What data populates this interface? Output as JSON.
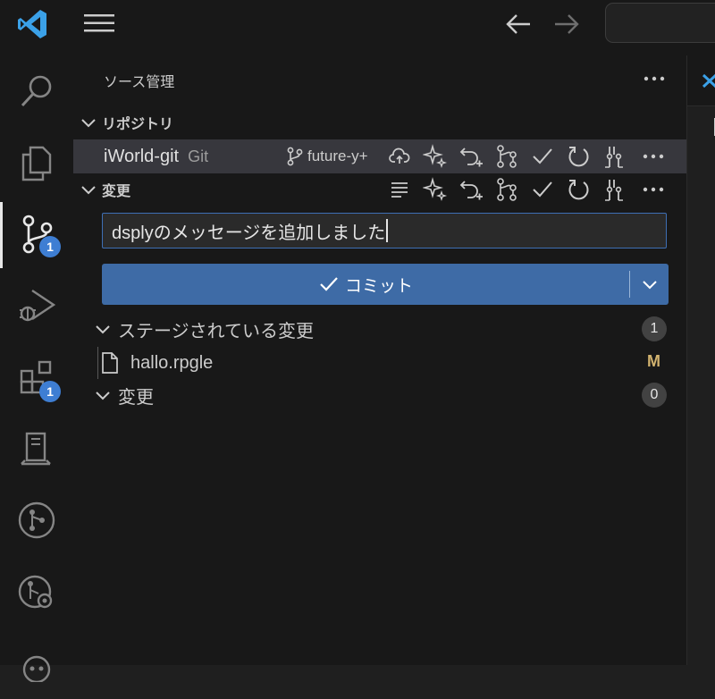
{
  "sidebar": {
    "title": "ソース管理",
    "repositories_header": "リポジトリ",
    "changes_header": "変更"
  },
  "repo": {
    "name": "iWorld-git",
    "provider": "Git",
    "branch": "future-y+"
  },
  "activity_bar": {
    "scm_badge": "1",
    "extensions_badge": "1"
  },
  "commit": {
    "message": "dsplyのメッセージを追加しました",
    "button_label": "コミット"
  },
  "groups": {
    "staged": {
      "label": "ステージされている変更",
      "count": "1"
    },
    "changes": {
      "label": "変更",
      "count": "0"
    }
  },
  "files": [
    {
      "name": "hallo.rpgle",
      "status": "M"
    }
  ],
  "colors": {
    "accent": "#3e6ba6",
    "badge": "#3e7ed3",
    "modified": "#d2b36f",
    "vscode_blue": "#3ba1e8"
  },
  "icons": {
    "title_bar": [
      "vscode-logo-icon",
      "hamburger-menu-icon",
      "arrow-left-icon",
      "arrow-right-icon"
    ],
    "activity_bar": [
      "search-icon",
      "explorer-icon",
      "source-control-icon",
      "run-debug-icon",
      "extensions-icon",
      "remote-explorer-icon",
      "git-graph-icon",
      "git-history-icon",
      "copilot-icon"
    ],
    "repo_toolbar": [
      "cloud-upload-icon",
      "sparkle-icon",
      "discard-icon",
      "graph-icon",
      "check-icon",
      "refresh-icon",
      "stash-icon",
      "more-icon"
    ],
    "changes_toolbar": [
      "list-view-icon",
      "sparkle-icon",
      "discard-icon",
      "graph-icon",
      "check-icon",
      "refresh-icon",
      "stash-icon",
      "more-icon"
    ]
  }
}
